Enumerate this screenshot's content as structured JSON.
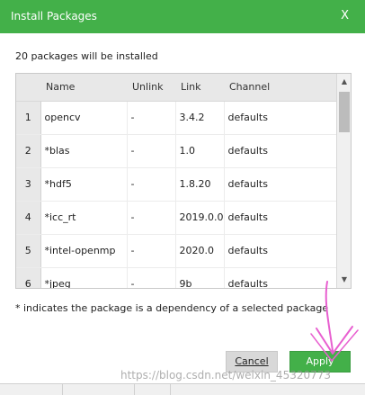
{
  "dialog": {
    "title": "Install Packages",
    "close_label": "X",
    "summary": "20 packages will be installed",
    "note": "* indicates the package is a dependency of a selected package",
    "cancel_label": "Cancel",
    "apply_label": "Apply",
    "watermark": "https://blog.csdn.net/weixin_45320773"
  },
  "table": {
    "headers": [
      "",
      "Name",
      "Unlink",
      "Link",
      "Channel"
    ],
    "rows": [
      {
        "num": "1",
        "name": "opencv",
        "unlink": "-",
        "link": "3.4.2",
        "channel": "defaults"
      },
      {
        "num": "2",
        "name": "*blas",
        "unlink": "-",
        "link": "1.0",
        "channel": "defaults"
      },
      {
        "num": "3",
        "name": "*hdf5",
        "unlink": "-",
        "link": "1.8.20",
        "channel": "defaults"
      },
      {
        "num": "4",
        "name": "*icc_rt",
        "unlink": "-",
        "link": "2019.0.0",
        "channel": "defaults"
      },
      {
        "num": "5",
        "name": "*intel-openmp",
        "unlink": "-",
        "link": "2020.0",
        "channel": "defaults"
      },
      {
        "num": "6",
        "name": "*jpeg",
        "unlink": "-",
        "link": "9b",
        "channel": "defaults"
      }
    ]
  },
  "colors": {
    "accent": "#43b049",
    "annotation": "#e85fd0"
  },
  "icons": {
    "scroll_up": "▲",
    "scroll_down": "▼"
  }
}
